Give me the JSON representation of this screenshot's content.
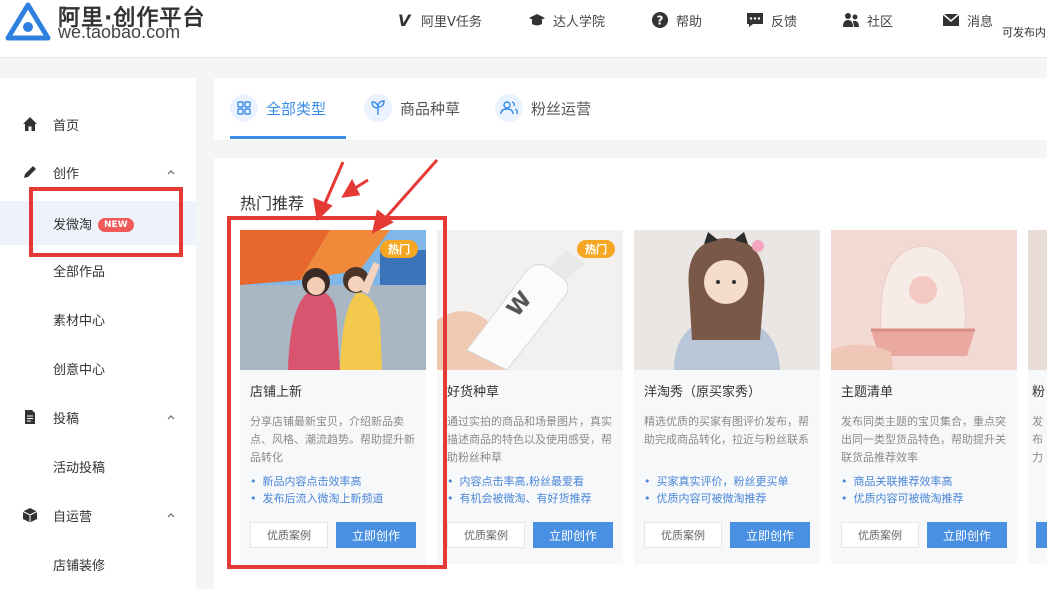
{
  "header": {
    "logo_title": "阿里·创作平台",
    "logo_url": "we.taobao.com",
    "nav": [
      {
        "label": "阿里V任务",
        "icon": "v-icon"
      },
      {
        "label": "达人学院",
        "icon": "graduation-cap-icon"
      },
      {
        "label": "帮助",
        "icon": "question-icon"
      },
      {
        "label": "反馈",
        "icon": "chat-icon"
      },
      {
        "label": "社区",
        "icon": "people-icon"
      },
      {
        "label": "消息",
        "icon": "mail-icon"
      }
    ]
  },
  "sidebar": {
    "items": [
      {
        "label": "首页",
        "icon": "home-icon"
      },
      {
        "label": "创作",
        "icon": "pencil-icon"
      },
      {
        "label": "发微淘",
        "badge": "NEW"
      },
      {
        "label": "全部作品"
      },
      {
        "label": "素材中心"
      },
      {
        "label": "创意中心"
      },
      {
        "label": "投稿",
        "icon": "document-icon"
      },
      {
        "label": "活动投稿"
      },
      {
        "label": "自运营",
        "icon": "box-icon"
      },
      {
        "label": "店铺装修"
      }
    ]
  },
  "tabs": {
    "items": [
      {
        "label": "全部类型",
        "icon": "grid-icon"
      },
      {
        "label": "商品种草",
        "icon": "sprout-icon"
      },
      {
        "label": "粉丝运营",
        "icon": "fans-icon"
      }
    ],
    "right_text": "可发布内"
  },
  "main": {
    "section_title": "热门推荐",
    "cards": [
      {
        "title": "店铺上新",
        "badge": "热门",
        "desc": "分享店铺最新宝贝，介绍新品卖点、风格、潮流趋势。帮助提升新品转化",
        "points": [
          "新品内容点击效率高",
          "发布后流入微淘上新频道"
        ],
        "case_label": "优质案例",
        "create_label": "立即创作"
      },
      {
        "title": "好货种草",
        "badge": "热门",
        "desc": "通过实拍的商品和场景图片，真实描述商品的特色以及使用感受，帮助粉丝种草",
        "points": [
          "内容点击率高,粉丝最爱看",
          "有机会被微淘、有好货推荐"
        ],
        "case_label": "优质案例",
        "create_label": "立即创作"
      },
      {
        "title": "洋淘秀（原买家秀）",
        "desc": "精选优质的买家有图评价发布，帮助完成商品转化，拉近与粉丝联系",
        "points": [
          "买家真实评价，粉丝更买单",
          "优质内容可被微淘推荐"
        ],
        "case_label": "优质案例",
        "create_label": "立即创作"
      },
      {
        "title": "主题清单",
        "desc": "发布同类主题的宝贝集合，重点突出同一类型货品特色，帮助提升关联货品推荐效率",
        "points": [
          "商品关联推荐效率高",
          "优质内容可被微淘推荐"
        ],
        "case_label": "优质案例",
        "create_label": "立即创作"
      },
      {
        "title": "粉",
        "desc": "发布力",
        "points": [],
        "case_label": "",
        "create_label": ""
      }
    ]
  },
  "colors": {
    "accent": "#3a8ee6",
    "hot_badge": "#f5a623",
    "new_badge": "#f05a5a",
    "annotation": "#e53935"
  }
}
